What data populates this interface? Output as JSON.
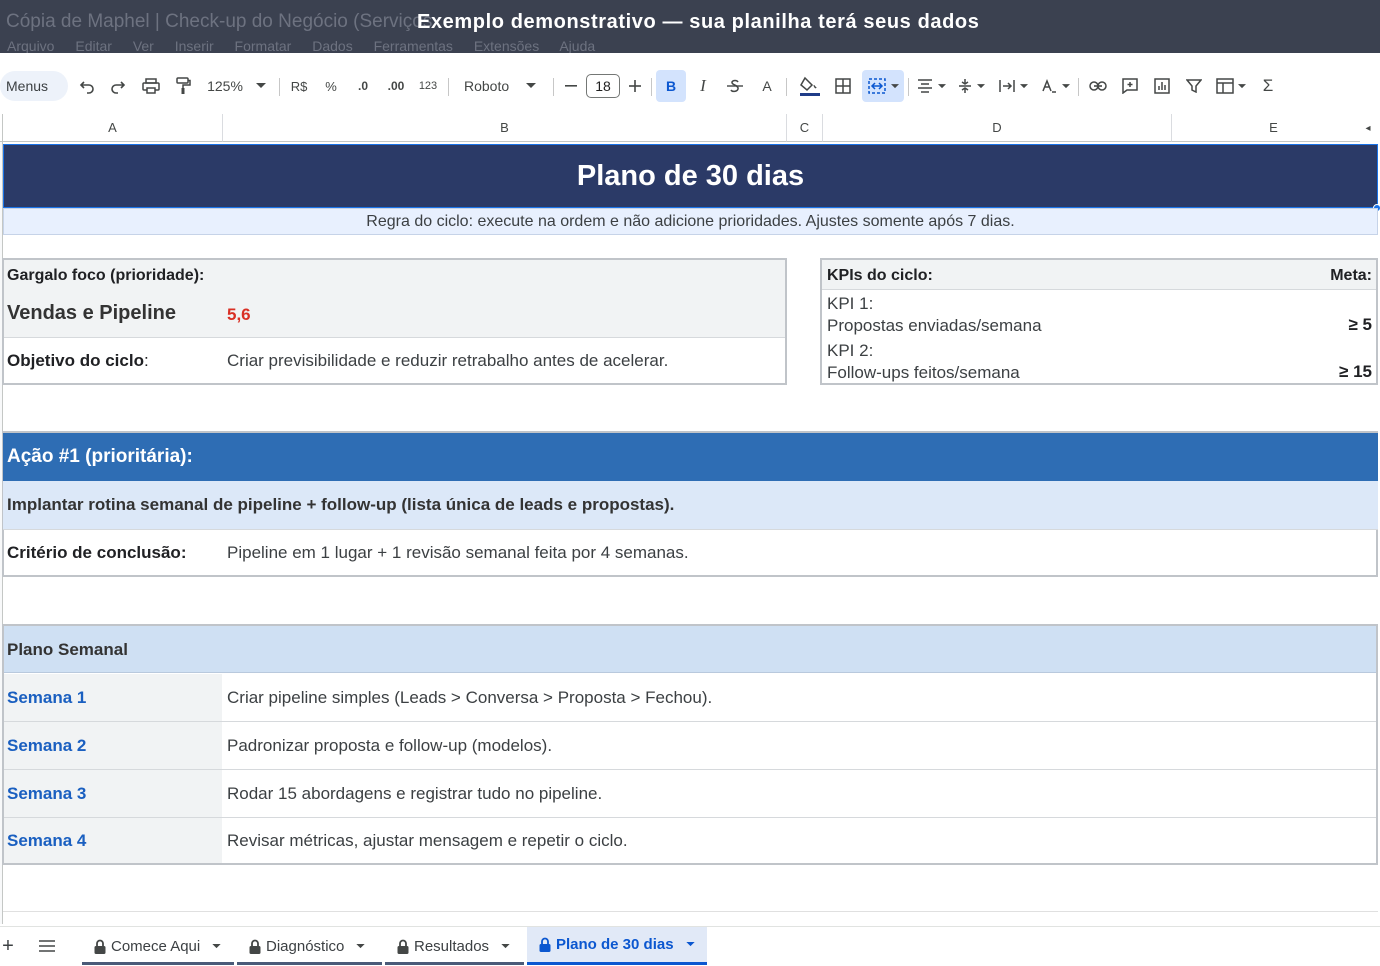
{
  "app": {
    "doc_title": "Cópia de Maphel | Check-up do Negócio (Serviços",
    "demo_banner": "Exemplo demonstrativo — sua planilha terá seus dados",
    "menu": [
      "Arquivo",
      "Editar",
      "Ver",
      "Inserir",
      "Formatar",
      "Dados",
      "Ferramentas",
      "Extensões",
      "Ajuda"
    ]
  },
  "toolbar": {
    "menus_label": "Menus",
    "zoom": "125%",
    "currency": "R$",
    "percent": "%",
    "dec_less": ".0",
    "dec_more": ".00",
    "number_format": "123",
    "font": "Roboto",
    "font_size": "18",
    "bold": "B",
    "italic": "I",
    "text_color_letter": "A",
    "text_color": "#1a73e8",
    "sum": "Σ"
  },
  "columns": [
    "A",
    "B",
    "C",
    "D",
    "E"
  ],
  "sheet": {
    "title": "Plano de 30 dias",
    "rule": "Regra do ciclo: execute na ordem e não adicione prioridades. Ajustes somente após 7 dias.",
    "focus": {
      "label": "Gargalo foco (prioridade):",
      "name": "Vendas e Pipeline",
      "score": "5,6",
      "objective_label": "Objetivo do ciclo",
      "objective_colon": ":",
      "objective_text": "Criar previsibilidade e reduzir retrabalho antes de acelerar."
    },
    "kpis": {
      "label": "KPIs do ciclo:",
      "meta_label": "Meta:",
      "items": [
        {
          "name": "KPI 1:",
          "desc": "Propostas enviadas/semana",
          "target": "≥ 5"
        },
        {
          "name": "KPI 2:",
          "desc": "Follow-ups feitos/semana",
          "target": "≥ 15"
        }
      ]
    },
    "action": {
      "header": "Ação #1 (prioritária):",
      "text": "Implantar rotina semanal de pipeline + follow-up (lista única de leads e propostas).",
      "criterion_label": "Critério de conclusão:",
      "criterion_text": "Pipeline em 1 lugar + 1 revisão semanal feita por 4 semanas."
    },
    "weekly": {
      "header": "Plano Semanal",
      "weeks": [
        {
          "label": "Semana 1",
          "text": "Criar pipeline simples (Leads > Conversa > Proposta > Fechou)."
        },
        {
          "label": "Semana 2",
          "text": "Padronizar proposta e follow-up (modelos)."
        },
        {
          "label": "Semana 3",
          "text": "Rodar 15 abordagens e registrar tudo no pipeline."
        },
        {
          "label": "Semana 4",
          "text": "Revisar métricas, ajustar mensagem e repetir o ciclo."
        }
      ]
    },
    "colors": {
      "title_bg": "#2b3a67",
      "section_bg": "#2e6db4",
      "score": "#d93025",
      "week_label": "#1a5fc0"
    }
  },
  "tabs": {
    "add": "+",
    "items": [
      {
        "label": "Comece Aqui",
        "active": false
      },
      {
        "label": "Diagnóstico",
        "active": false
      },
      {
        "label": "Resultados",
        "active": false
      },
      {
        "label": "Plano de 30 dias",
        "active": true
      }
    ]
  }
}
